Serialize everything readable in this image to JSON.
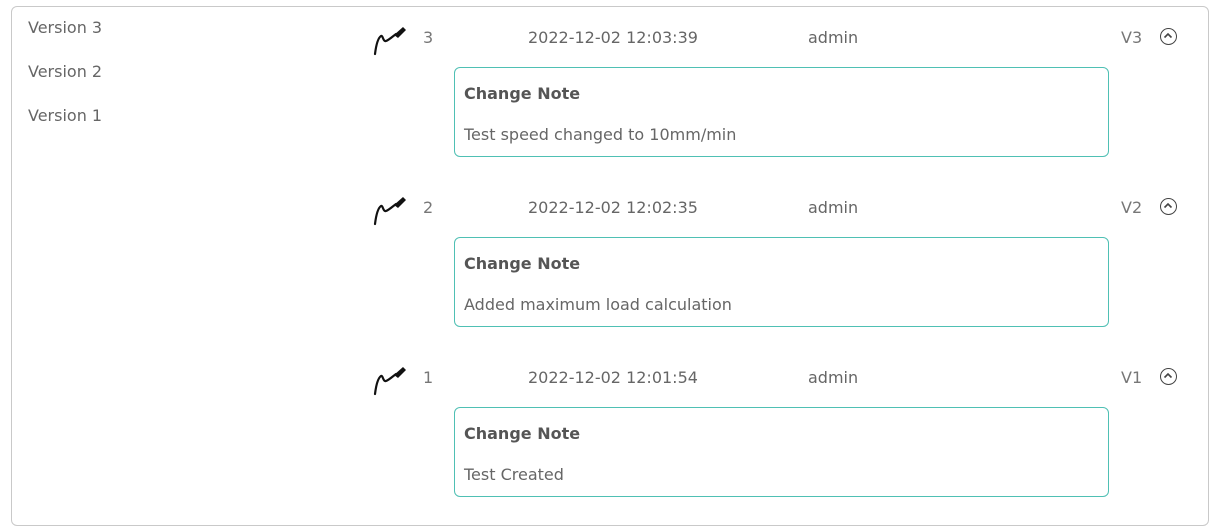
{
  "sidebar": {
    "items": [
      {
        "label": "Version 3"
      },
      {
        "label": "Version 2"
      },
      {
        "label": "Version 1"
      }
    ]
  },
  "entries": [
    {
      "number": "3",
      "date": "2022-12-02 12:03:39",
      "user": "admin",
      "version": "V3",
      "note_title": "Change Note",
      "note_text": "Test speed changed to 10mm/min",
      "icon": "signature-icon",
      "toggle_icon": "chevron-up-icon"
    },
    {
      "number": "2",
      "date": "2022-12-02 12:02:35",
      "user": "admin",
      "version": "V2",
      "note_title": "Change Note",
      "note_text": "Added maximum load calculation",
      "icon": "signature-icon",
      "toggle_icon": "chevron-up-icon"
    },
    {
      "number": "1",
      "date": "2022-12-02 12:01:54",
      "user": "admin",
      "version": "V1",
      "note_title": "Change Note",
      "note_text": "Test Created",
      "icon": "signature-icon",
      "toggle_icon": "chevron-up-icon"
    }
  ],
  "colors": {
    "note_border": "#4fc0b4",
    "frame_border": "#c9c9c9",
    "text": "#666666"
  }
}
